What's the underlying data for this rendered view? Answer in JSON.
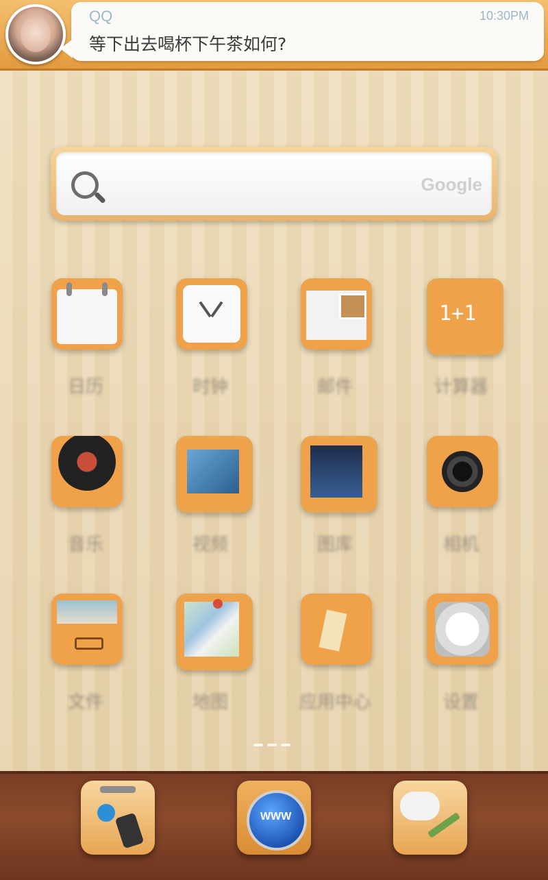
{
  "notification": {
    "sender": "QQ",
    "time": "10:30PM",
    "message": "等下出去喝杯下午茶如何?"
  },
  "search": {
    "brand": "Google"
  },
  "apps": [
    {
      "label": "日历",
      "icon": "calendar-icon"
    },
    {
      "label": "时钟",
      "icon": "clock-icon"
    },
    {
      "label": "邮件",
      "icon": "mail-icon"
    },
    {
      "label": "计算器",
      "icon": "calculator-icon"
    },
    {
      "label": "音乐",
      "icon": "music-icon"
    },
    {
      "label": "视频",
      "icon": "video-icon"
    },
    {
      "label": "图库",
      "icon": "gallery-icon"
    },
    {
      "label": "相机",
      "icon": "camera-icon"
    },
    {
      "label": "文件",
      "icon": "files-icon"
    },
    {
      "label": "地图",
      "icon": "map-icon"
    },
    {
      "label": "应用中心",
      "icon": "app-store-icon"
    },
    {
      "label": "设置",
      "icon": "settings-icon"
    }
  ],
  "dock": [
    {
      "icon": "contacts-icon"
    },
    {
      "icon": "browser-icon",
      "text": "WWW"
    },
    {
      "icon": "messaging-icon"
    }
  ],
  "calculator_glyph": "1+1"
}
